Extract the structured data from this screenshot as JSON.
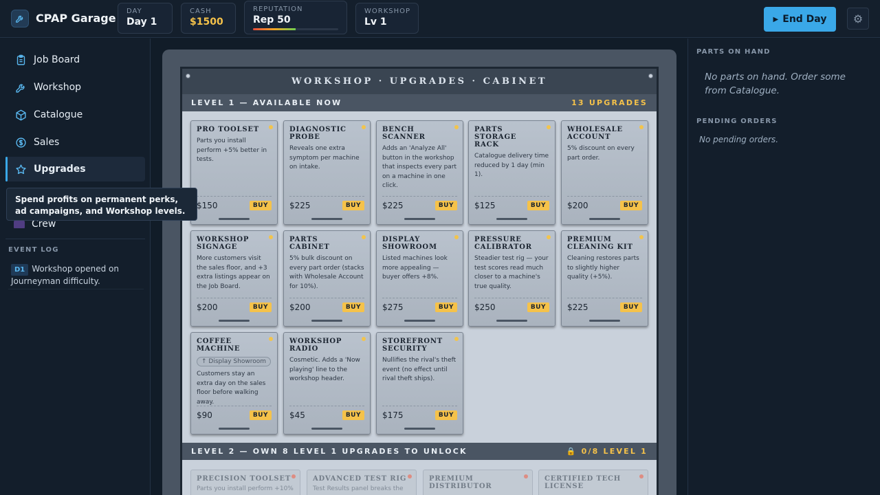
{
  "app": {
    "title": "CPAP Garage"
  },
  "stats": {
    "day": {
      "label": "DAY",
      "value": "Day 1"
    },
    "cash": {
      "label": "CASH",
      "value": "$1500"
    },
    "reputation": {
      "label": "REPUTATION",
      "value": "Rep 50",
      "progress": 0.5
    },
    "workshop": {
      "label": "WORKSHOP",
      "value": "Lv 1"
    }
  },
  "actions": {
    "end_day": "End Day"
  },
  "sidebar": {
    "items": [
      {
        "label": "Job Board",
        "icon": "clipboard-icon"
      },
      {
        "label": "Workshop",
        "icon": "wrench-icon"
      },
      {
        "label": "Catalogue",
        "icon": "cube-icon"
      },
      {
        "label": "Sales",
        "icon": "dollar-icon"
      },
      {
        "label": "Upgrades",
        "icon": "star-icon",
        "active": true
      },
      {
        "label": "Crew",
        "icon": "crew-icon"
      }
    ],
    "tooltip": "Spend profits on permanent perks, ad campaigns, and Workshop levels.",
    "event_log": {
      "title": "EVENT LOG",
      "entries": [
        {
          "badge": "D1",
          "text": "Workshop opened on Journeyman difficulty."
        }
      ]
    }
  },
  "cabinet": {
    "title": "WORKSHOP · UPGRADES · CABINET",
    "level1": {
      "label": "LEVEL 1 — AVAILABLE NOW",
      "count": "13 UPGRADES"
    },
    "level2": {
      "label": "LEVEL 2 — OWN 8 LEVEL 1 UPGRADES TO UNLOCK",
      "status": "0/8 LEVEL 1"
    },
    "buy_label": "BUY",
    "upgrades": [
      {
        "name": "PRO TOOLSET",
        "desc": "Parts you install perform +5% better in tests.",
        "price": "$150"
      },
      {
        "name": "DIAGNOSTIC PROBE",
        "desc": "Reveals one extra symptom per machine on intake.",
        "price": "$225"
      },
      {
        "name": "BENCH SCANNER",
        "desc": "Adds an 'Analyze All' button in the workshop that inspects every part on a machine in one click.",
        "price": "$225"
      },
      {
        "name": "PARTS STORAGE RACK",
        "desc": "Catalogue delivery time reduced by 1 day (min 1).",
        "price": "$125"
      },
      {
        "name": "WHOLESALE ACCOUNT",
        "desc": "5% discount on every part order.",
        "price": "$200"
      },
      {
        "name": "WORKSHOP SIGNAGE",
        "desc": "More customers visit the sales floor, and +3 extra listings appear on the Job Board.",
        "price": "$200"
      },
      {
        "name": "PARTS CABINET",
        "desc": "5% bulk discount on every part order (stacks with Wholesale Account for 10%).",
        "price": "$200"
      },
      {
        "name": "DISPLAY SHOWROOM",
        "desc": "Listed machines look more appealing — buyer offers +8%.",
        "price": "$275"
      },
      {
        "name": "PRESSURE CALIBRATOR",
        "desc": "Steadier test rig — your test scores read much closer to a machine's true quality.",
        "price": "$250"
      },
      {
        "name": "PREMIUM CLEANING KIT",
        "desc": "Cleaning restores parts to slightly higher quality (+5%).",
        "price": "$225"
      },
      {
        "name": "COFFEE MACHINE",
        "req": "↑ Display Showroom",
        "desc": "Customers stay an extra day on the sales floor before walking away.",
        "price": "$90"
      },
      {
        "name": "WORKSHOP RADIO",
        "desc": "Cosmetic. Adds a 'Now playing' line to the workshop header.",
        "price": "$45"
      },
      {
        "name": "STOREFRONT SECURITY",
        "desc": "Nullifies the rival's theft event (no effect until rival theft ships).",
        "price": "$175"
      }
    ],
    "locked": [
      {
        "name": "PRECISION TOOLSET",
        "desc": "Parts you install perform +10%"
      },
      {
        "name": "ADVANCED TEST RIG",
        "desc": "Test Results panel breaks the"
      },
      {
        "name": "PREMIUM DISTRIBUTOR",
        "desc": ""
      },
      {
        "name": "CERTIFIED TECH LICENSE",
        "desc": ""
      }
    ]
  },
  "right_panel": {
    "parts_title": "PARTS ON HAND",
    "parts_empty": "No parts on hand. Order some from Catalogue.",
    "orders_title": "PENDING ORDERS",
    "orders_empty": "No pending orders."
  },
  "colors": {
    "accent": "#3aa8e8",
    "cash": "#f5c24a",
    "buy": "#f5c24a"
  }
}
